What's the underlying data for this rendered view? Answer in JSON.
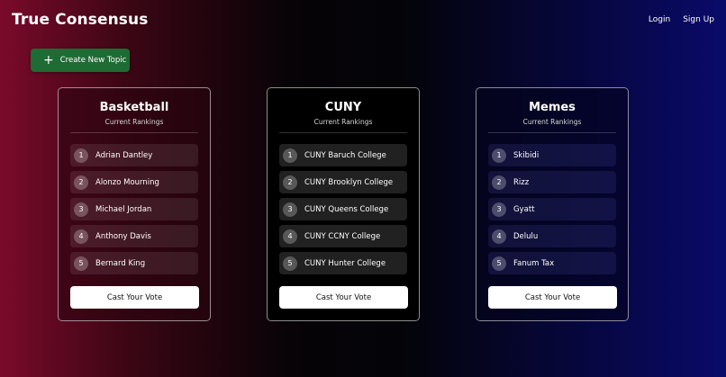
{
  "header": {
    "brand": "True Consensus",
    "login": "Login",
    "signup": "Sign Up"
  },
  "create_button": {
    "label": "Create New Topic",
    "icon": "plus-icon",
    "color": "#1f6b34"
  },
  "topics": [
    {
      "title": "Basketball",
      "subtitle": "Current Rankings",
      "items": [
        {
          "rank": "1",
          "name": "Adrian Dantley"
        },
        {
          "rank": "2",
          "name": "Alonzo Mourning"
        },
        {
          "rank": "3",
          "name": "Michael Jordan"
        },
        {
          "rank": "4",
          "name": "Anthony Davis"
        },
        {
          "rank": "5",
          "name": "Bernard King"
        }
      ],
      "vote_label": "Cast Your Vote"
    },
    {
      "title": "CUNY",
      "subtitle": "Current Rankings",
      "items": [
        {
          "rank": "1",
          "name": "CUNY Baruch College"
        },
        {
          "rank": "2",
          "name": "CUNY Brooklyn College"
        },
        {
          "rank": "3",
          "name": "CUNY Queens College"
        },
        {
          "rank": "4",
          "name": "CUNY CCNY College"
        },
        {
          "rank": "5",
          "name": "CUNY Hunter College"
        }
      ],
      "vote_label": "Cast Your Vote"
    },
    {
      "title": "Memes",
      "subtitle": "Current Rankings",
      "items": [
        {
          "rank": "1",
          "name": "Skibidi"
        },
        {
          "rank": "2",
          "name": "Rizz"
        },
        {
          "rank": "3",
          "name": "Gyatt"
        },
        {
          "rank": "4",
          "name": "Delulu"
        },
        {
          "rank": "5",
          "name": "Fanum Tax"
        }
      ],
      "vote_label": "Cast Your Vote"
    }
  ]
}
